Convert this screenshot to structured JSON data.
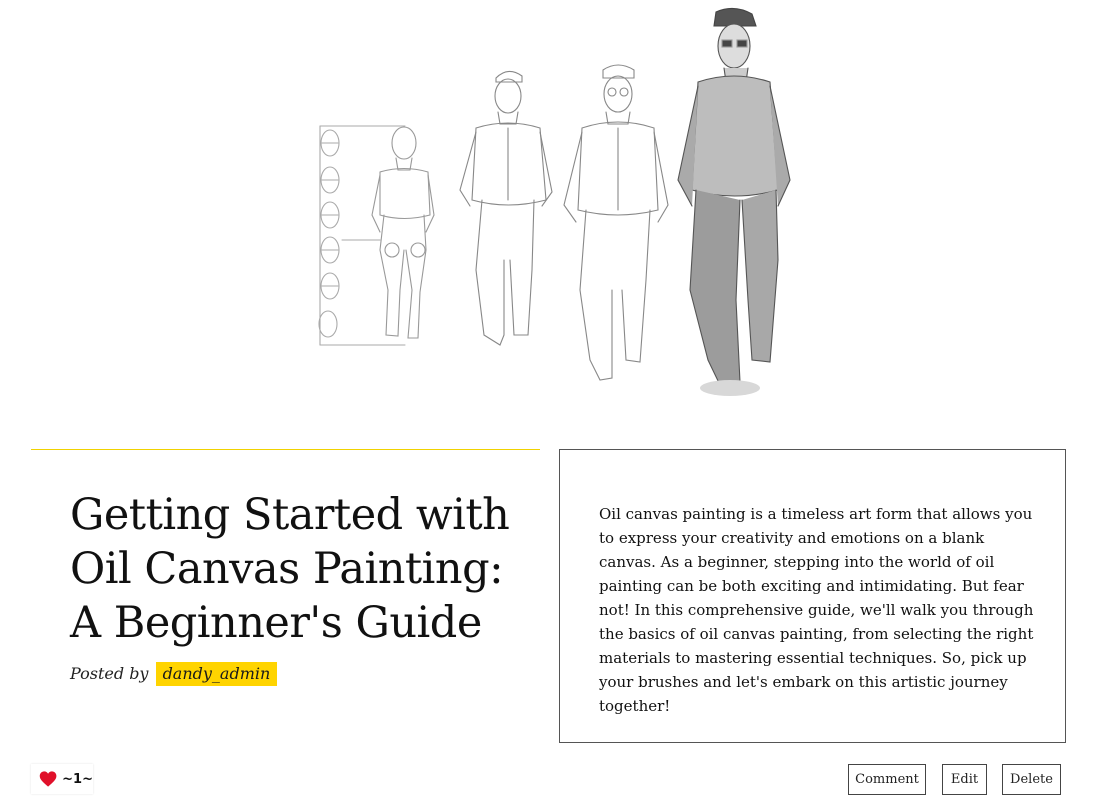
{
  "post": {
    "title": "Getting Started with Oil Canvas Painting: A Beginner's Guide",
    "byline_prefix": "Posted by",
    "author": "dandy_admin",
    "intro": "Oil canvas painting is a timeless art form that allows you to express your creativity and emotions on a blank canvas. As a beginner, stepping into the world of oil painting can be both exciting and intimidating. But fear not! In this comprehensive guide, we'll walk you through the basics of oil canvas painting, from selecting the right materials to mastering essential techniques. So, pick up your brushes and let's embark on this artistic journey together!"
  },
  "likes": {
    "count": "~1~",
    "icon": "heart-icon",
    "color": "#e0102a"
  },
  "actions": {
    "comment_label": "Comment",
    "edit_label": "Edit",
    "delete_label": "Delete"
  },
  "colors": {
    "accent": "#ffd400",
    "divider": "#f0d200"
  }
}
